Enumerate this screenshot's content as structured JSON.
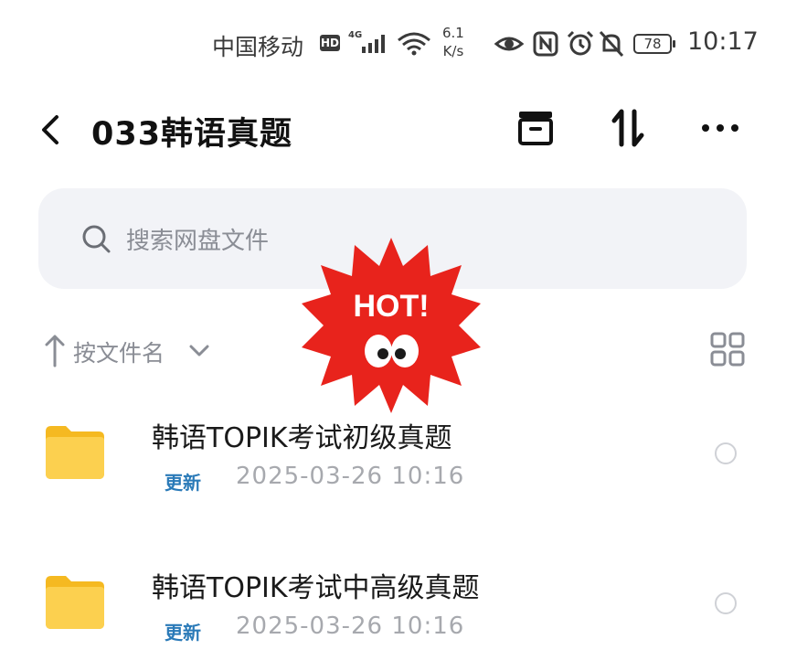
{
  "status_bar": {
    "carrier": "中国移动",
    "hd": "HD",
    "network": "4G",
    "speed_value": "6.1",
    "speed_unit": "K/s",
    "battery": "78",
    "time": "10:17",
    "icons": [
      "signal-bars-icon",
      "wifi-icon",
      "eye-icon",
      "nfc-icon",
      "alarm-icon",
      "mute-icon",
      "battery-icon"
    ]
  },
  "header": {
    "title": "033韩语真题",
    "icons": [
      "back-icon",
      "archive-icon",
      "sort-icon",
      "more-icon"
    ]
  },
  "search": {
    "placeholder": "搜索网盘文件"
  },
  "sort": {
    "label": "按文件名"
  },
  "badge": {
    "text": "HOT!"
  },
  "files": [
    {
      "name": "韩语TOPIK考试初级真题",
      "tag": "更新",
      "date": "2025-03-26  10:16"
    },
    {
      "name": "韩语TOPIK考试中高级真题",
      "tag": "更新",
      "date": "2025-03-26  10:16"
    }
  ],
  "colors": {
    "accent_blue": "#2a7ab8",
    "badge_red": "#e8231c",
    "folder_yellow": "#f9c53a",
    "search_bg": "#f2f3f7"
  }
}
